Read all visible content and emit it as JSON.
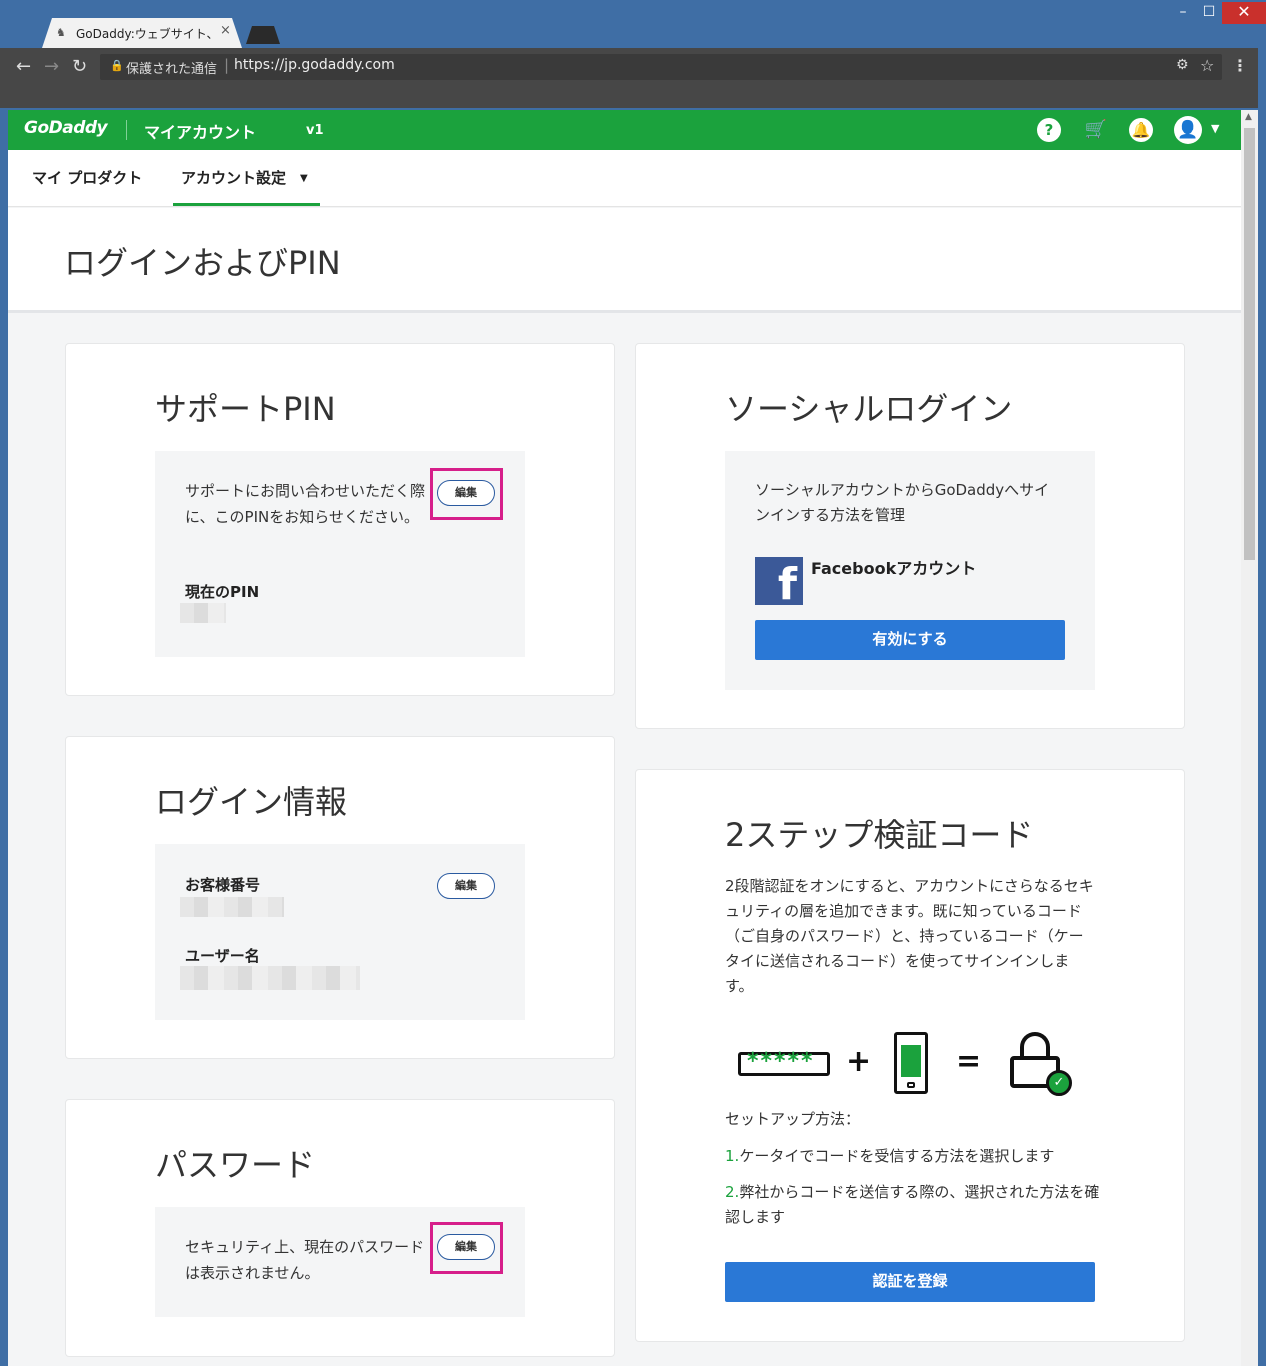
{
  "browser": {
    "tab_title": "GoDaddy:ウェブサイト、ホ",
    "tab_close": "×",
    "secure_label": "保護された通信",
    "url": "https://jp.godaddy.com",
    "min": "–",
    "max": "☐",
    "close": "✕"
  },
  "header": {
    "logo": "GoDaddy",
    "my_account": "マイアカウント",
    "version": "v1",
    "help": "?"
  },
  "subnav": {
    "products": "マイ プロダクト",
    "settings": "アカウント設定"
  },
  "page": {
    "title": "ログインおよびPIN"
  },
  "support_pin": {
    "title": "サポートPIN",
    "description": "サポートにお問い合わせいただく際に、このPINをお知らせください。",
    "edit": "編集",
    "current_pin_label": "現在のPIN"
  },
  "login_info": {
    "title": "ログイン情報",
    "customer_number_label": "お客様番号",
    "edit": "編集",
    "username_label": "ユーザー名"
  },
  "password": {
    "title": "パスワード",
    "description": "セキュリティ上、現在のパスワードは表示されません。",
    "edit": "編集"
  },
  "social_login": {
    "title": "ソーシャルログイン",
    "description": "ソーシャルアカウントからGoDaddyへサインインする方法を管理",
    "facebook_label": "Facebookアカウント",
    "enable_button": "有効にする"
  },
  "two_step": {
    "title": "2ステップ検証コード",
    "description": "2段階認証をオンにすると、アカウントにさらなるセキュリティの層を追加できます。既に知っているコード（ご自身のパスワード）と、持っているコード（ケータイに送信されるコード）を使ってサインインします。",
    "plus": "+",
    "equals": "=",
    "password_stars": "*****",
    "setup_label": "セットアップ方法：",
    "step1_num": "1.",
    "step1_text": "ケータイでコードを受信する方法を選択します",
    "step2_num": "2.",
    "step2_text": "弊社からコードを送信する際の、選択された方法を確認します",
    "register_button": "認証を登録"
  },
  "colors": {
    "brand_green": "#1ba23d",
    "button_blue": "#2a78d6",
    "highlight_magenta": "#d61f8a",
    "facebook_blue": "#3b5998"
  }
}
